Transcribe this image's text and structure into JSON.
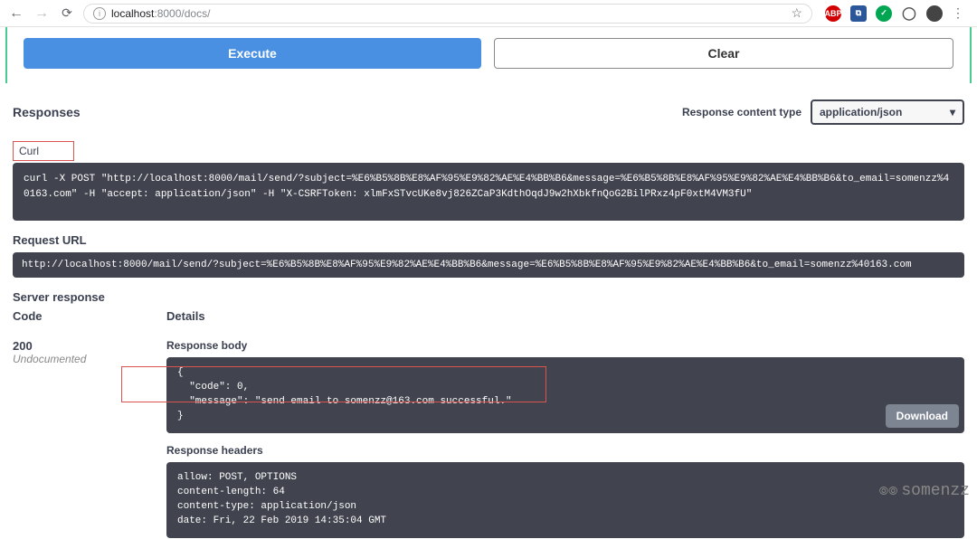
{
  "browser": {
    "url_host": "localhost",
    "url_port": ":8000",
    "url_path": "/docs/"
  },
  "actions": {
    "execute": "Execute",
    "clear": "Clear"
  },
  "responses": {
    "title": "Responses",
    "content_type_label": "Response content type",
    "content_type_value": "application/json"
  },
  "curl": {
    "label": "Curl",
    "command": "curl -X POST \"http://localhost:8000/mail/send/?subject=%E6%B5%8B%E8%AF%95%E9%82%AE%E4%BB%B6&message=%E6%B5%8B%E8%AF%95%E9%82%AE%E4%BB%B6&to_email=somenzz%40163.com\" -H \"accept: application/json\" -H \"X-CSRFToken: xlmFxSTvcUKe8vj826ZCaP3KdthOqdJ9w2hXbkfnQoG2BilPRxz4pF0xtM4VM3fU\""
  },
  "request_url": {
    "label": "Request URL",
    "value": "http://localhost:8000/mail/send/?subject=%E6%B5%8B%E8%AF%95%E9%82%AE%E4%BB%B6&message=%E6%B5%8B%E8%AF%95%E9%82%AE%E4%BB%B6&to_email=somenzz%40163.com"
  },
  "server_response": {
    "label": "Server response",
    "code_header": "Code",
    "details_header": "Details",
    "code": "200",
    "code_desc": "Undocumented",
    "body_label": "Response body",
    "body": "{\n  \"code\": 0,\n  \"message\": \"send email to somenzz@163.com successful.\"\n}",
    "download": "Download",
    "headers_label": "Response headers",
    "headers": "allow: POST, OPTIONS\ncontent-length: 64\ncontent-type: application/json\ndate: Fri, 22 Feb 2019 14:35:04 GMT"
  },
  "watermark": "somenzz"
}
